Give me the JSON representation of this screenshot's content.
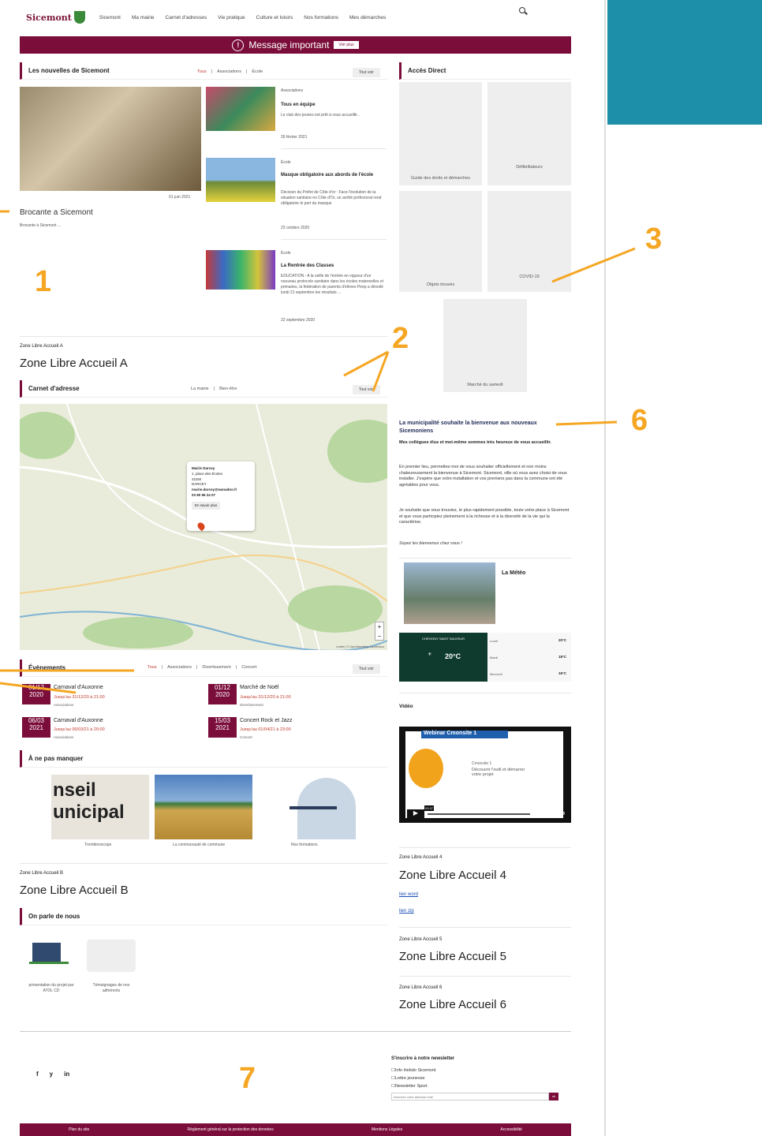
{
  "header": {
    "logo": "Sicemont",
    "nav": [
      "Sicemont",
      "Ma mairie",
      "Carnet d'adresses",
      "Vie pratique",
      "Culture et loisirs",
      "Nos formations",
      "Mes démarches"
    ]
  },
  "alert": {
    "title": "Message important",
    "button": "Voir plus"
  },
  "news": {
    "title": "Les nouvelles de Sicemont",
    "filters": [
      "Tous",
      "Associations",
      "École"
    ],
    "tout_voir": "Tout voir",
    "featured": {
      "date": "01 juin 2021",
      "title": "Brocante a Sicemont",
      "excerpt": "Brocante à Sicemont ..."
    },
    "items": [
      {
        "category": "Associations",
        "title": "Tous en équipe",
        "excerpt": "Le club des jeunes est prêt à vous accueillir...",
        "date": "26 février 2021"
      },
      {
        "category": "École",
        "title": "Masque obligatoire aux abords de l'école",
        "excerpt": "Décision du Préfet de Côte d'or : Face l'évolution de la situation sanitaire en Côte d'Or, un arrêté préfectoral rend obligatoire le port du masque",
        "date": "23 octobre 2020"
      },
      {
        "category": "École",
        "title": "La Rentrée des Classes",
        "excerpt": "EDUCATION - A la veille de l'entrée en vigueur d'un nouveau protocole sanitaire dans les écoles maternelles et primaires, la fédération de parents d'élèves Peep a dévoilé lundi 21 septembre les résultats ...",
        "date": "22 septembre 2020"
      }
    ]
  },
  "acces": {
    "title": "Accès Direct",
    "cards": [
      "Guide des droits et démarches",
      "Défibrillateurs",
      "Objets trouvés",
      "COVID-19",
      "Marché du samedi"
    ]
  },
  "zoneA": {
    "small": "Zone Libre Accueil A",
    "title": "Zone Libre Accueil A"
  },
  "carnet": {
    "title": "Carnet d'adresse",
    "filters": [
      "La mairie",
      "Bien-être"
    ],
    "tout_voir": "Tout voir",
    "popup": {
      "name": "Mairie Darcey",
      "address": "1, place des Écoles",
      "zip": "21150",
      "city": "DARCEY",
      "email": "mairie.darcey@wanadoo.fr",
      "phone": "03 80 96 24 07",
      "button": "En savoir plus"
    },
    "attribution": "Leaflet | © OpenStreetMap contributors"
  },
  "events": {
    "title": "Évènements",
    "filters": [
      "Tous",
      "Associations",
      "Divertissement",
      "Concert"
    ],
    "tout_voir": "Tout voir",
    "items": [
      {
        "day": "01/12",
        "year": "2020",
        "title": "Carnaval d'Auxonne",
        "when": "Jusqu'au 31/12/20 à 21:00",
        "cat": "Associations"
      },
      {
        "day": "01/12",
        "year": "2020",
        "title": "Marché de Noël",
        "when": "Jusqu'au 31/12/20 à 21:00",
        "cat": "Divertissement"
      },
      {
        "day": "06/03",
        "year": "2021",
        "title": "Carnaval d'Auxonne",
        "when": "Jusqu'au 06/03/21 à 20:00",
        "cat": "Associations"
      },
      {
        "day": "15/03",
        "year": "2021",
        "title": "Concert Rock et Jazz",
        "when": "Jusqu'au 01/04/21 à 23:00",
        "cat": "Concert"
      }
    ]
  },
  "manquer": {
    "title": "À ne pas manquer",
    "items": [
      "Trombinoscope",
      "La communauté de commune",
      "Nos formations"
    ],
    "poster": [
      "nseil",
      "unicipal"
    ]
  },
  "zoneB": {
    "small": "Zone Libre Accueil B",
    "title": "Zone Libre Accueil B"
  },
  "parle": {
    "title": "On parle de nous",
    "items": [
      "présentation du projet par ATOL CD",
      "Témoignages de nos adhérents"
    ]
  },
  "welcome": {
    "title": "La municipalité souhaite la bienvenue aux nouveaux Sicemoniens",
    "lead": "Mes collègues élus et moi-même sommes très heureux de vous accueillir.",
    "p1": "En premier lieu, permettez-moi de vous souhaiter officiellement et non moins chaleureusement la bienvenue à Sicemont. Sicemont, ville où vous avez choisi de vous installer. J'espère que votre installation et vos premiers pas dans la commune ont été agréables pour vous.",
    "p2": "Je souhaite que vous trouviez, le plus rapidement possible, toute votre place à Sicemont et que vous participiez pleinement à la richesse et à la diversité de la vie qui la caractérise.",
    "p3": "Soyez les bienvenus chez vous !"
  },
  "meteo": {
    "title": "La Météo",
    "city": "CHEVIGNY SAINT SAUVEUR",
    "temp": "20°C",
    "days": [
      {
        "day": "Lundi",
        "temp": "20°C"
      },
      {
        "day": "Mardi",
        "temp": "18°C"
      },
      {
        "day": "Mercredi",
        "temp": "19°C"
      }
    ]
  },
  "video": {
    "title": "Vidéo",
    "banner": "Webinar Cmonsite 1",
    "sub": "Cmonsite 1",
    "desc": "Découvrir l'outil et démarrer votre projet",
    "brand": "vimeo",
    "time": "03:37"
  },
  "zone4": {
    "small": "Zone Libre Accueil 4",
    "title": "Zone Libre Accueil 4",
    "links": [
      "lien word",
      "lien zip"
    ]
  },
  "zone5": {
    "small": "Zone Libre Accueil 5",
    "title": "Zone Libre Accueil 5"
  },
  "zone6": {
    "small": "Zone Libre Accueil 6",
    "title": "Zone Libre Accueil 6"
  },
  "newsletter": {
    "title": "S'inscrire à notre newsletter",
    "options": [
      "Info Hebdo Sicemont",
      "Lettre jeunesse",
      "Newsletter Sport"
    ],
    "placeholder": "Inscrivez votre adresse mail",
    "button": "ok"
  },
  "social": [
    "f",
    "y",
    "in"
  ],
  "footer": [
    "Plan du site",
    "Règlement général sur la protection des données",
    "Mentions Légales",
    "Accessibilité"
  ],
  "annotations": [
    "1",
    "2",
    "3",
    "6",
    "7"
  ]
}
